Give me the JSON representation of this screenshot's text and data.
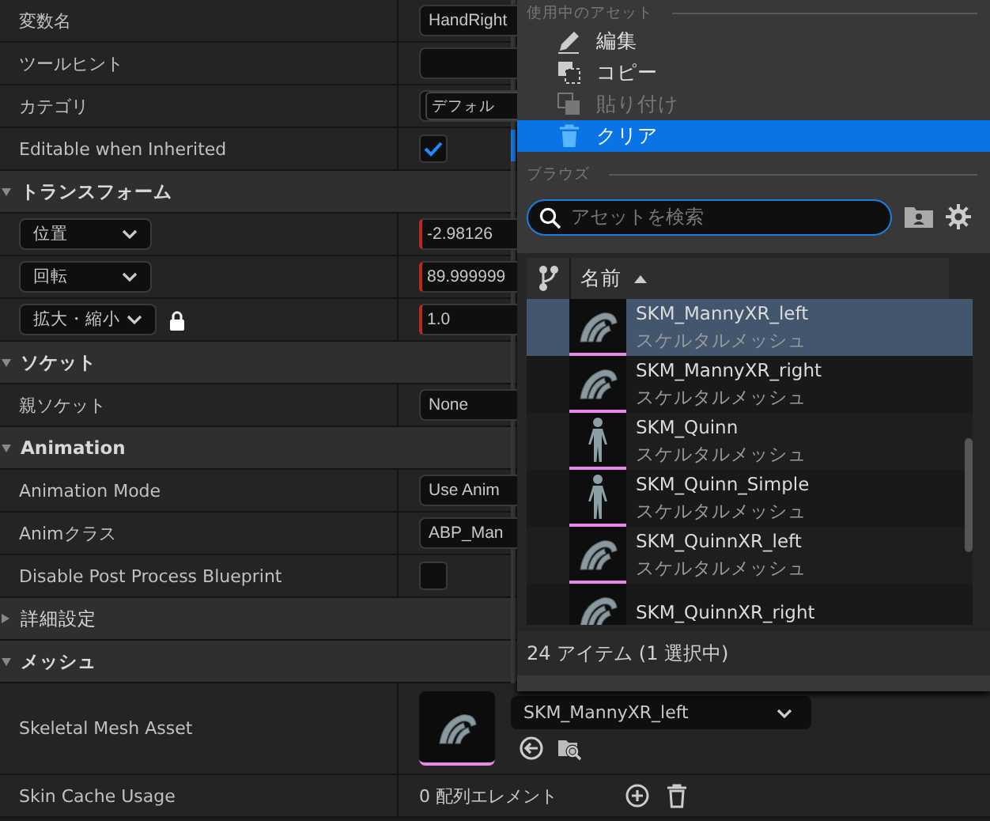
{
  "details": {
    "rows": [
      {
        "kind": "field",
        "label": "変数名",
        "value": "HandRight"
      },
      {
        "kind": "field",
        "label": "ツールヒント"
      },
      {
        "kind": "combo",
        "label": "カテゴリ",
        "value": "デフォル"
      },
      {
        "kind": "checkbox",
        "label": "Editable when Inherited",
        "checked": true
      },
      {
        "kind": "section",
        "label": "トランスフォーム",
        "expanded": true
      },
      {
        "kind": "transform",
        "label": "位置",
        "value": "-2.98126"
      },
      {
        "kind": "transform",
        "label": "回転",
        "value": "89.999999"
      },
      {
        "kind": "transform",
        "label": "拡大・縮小",
        "value": "1.0",
        "locked": true
      },
      {
        "kind": "section",
        "label": "ソケット",
        "expanded": true
      },
      {
        "kind": "field",
        "label": "親ソケット",
        "value": "None"
      },
      {
        "kind": "section",
        "label": "Animation",
        "expanded": true
      },
      {
        "kind": "field",
        "label": "Animation Mode",
        "value": "Use Anim"
      },
      {
        "kind": "field",
        "label": "Animクラス",
        "value": "ABP_Man"
      },
      {
        "kind": "checkbox",
        "label": "Disable Post Process Blueprint",
        "checked": false
      },
      {
        "kind": "section",
        "label": "詳細設定",
        "expanded": false
      },
      {
        "kind": "section",
        "label": "メッシュ",
        "expanded": true
      },
      {
        "kind": "asset",
        "label": "Skeletal Mesh Asset",
        "value": "SKM_MannyXR_left"
      },
      {
        "kind": "array",
        "label": "Skin Cache Usage",
        "value": "0 配列エレメント"
      }
    ]
  },
  "picker": {
    "header": "使用中のアセット",
    "actions": [
      {
        "label": "編集",
        "disabled": false,
        "selected": false
      },
      {
        "label": "コピー",
        "disabled": false,
        "selected": false
      },
      {
        "label": "貼り付け",
        "disabled": true,
        "selected": false
      },
      {
        "label": "クリア",
        "disabled": false,
        "selected": true
      }
    ],
    "browse_header": "ブラウズ",
    "search": {
      "placeholder": "アセットを検索"
    },
    "column": "名前",
    "assets": [
      {
        "name": "SKM_MannyXR_left",
        "type": "スケルタルメッシュ",
        "kind": "hand",
        "selected": true
      },
      {
        "name": "SKM_MannyXR_right",
        "type": "スケルタルメッシュ",
        "kind": "hand",
        "selected": false
      },
      {
        "name": "SKM_Quinn",
        "type": "スケルタルメッシュ",
        "kind": "figure",
        "selected": false
      },
      {
        "name": "SKM_Quinn_Simple",
        "type": "スケルタルメッシュ",
        "kind": "figure",
        "selected": false
      },
      {
        "name": "SKM_QuinnXR_left",
        "type": "スケルタルメッシュ",
        "kind": "hand",
        "selected": false
      },
      {
        "name": "SKM_QuinnXR_right",
        "kind": "hand",
        "selected": false
      }
    ],
    "status": "24 アイテム (1 選択中)"
  }
}
